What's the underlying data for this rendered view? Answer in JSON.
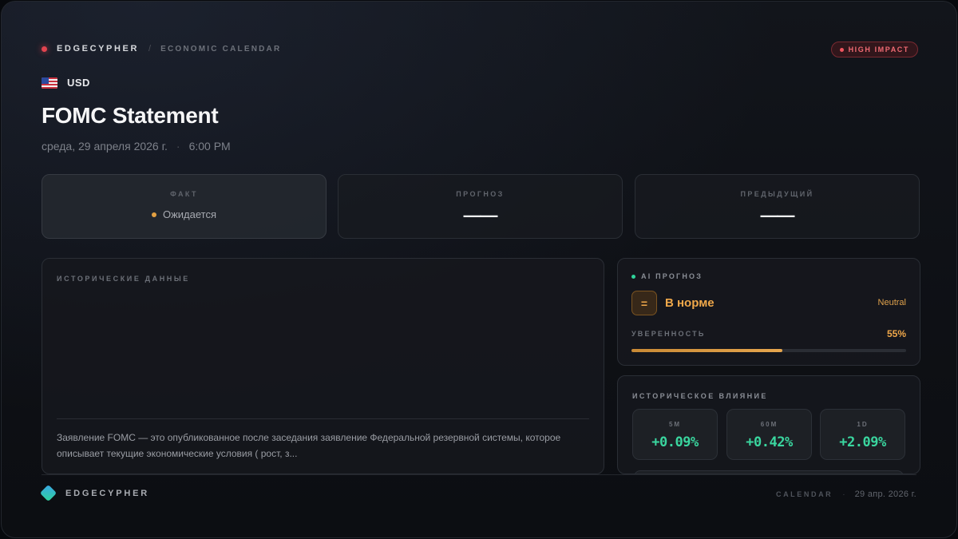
{
  "header": {
    "brand": "EDGECYPHER",
    "separator": "/",
    "breadcrumb": "ECONOMIC CALENDAR",
    "impact_badge": "HIGH IMPACT"
  },
  "event": {
    "currency": "USD",
    "title": "FOMC Statement",
    "date": "среда, 29 апреля 2026 г.",
    "time": "6:00 PM"
  },
  "stats": {
    "actual": {
      "label": "ФАКТ",
      "value": "Ожидается"
    },
    "forecast": {
      "label": "ПРОГНОЗ",
      "value": "——"
    },
    "previous": {
      "label": "ПРЕДЫДУЩИЙ",
      "value": "——"
    }
  },
  "historical": {
    "title": "ИСТОРИЧЕСКИЕ ДАННЫЕ",
    "description": "Заявление FOMC — это опубликованное после заседания заявление Федеральной резервной системы, которое описывает текущие экономические условия ( рост, з..."
  },
  "ai_forecast": {
    "title": "AI ПРОГНОЗ",
    "icon_symbol": "=",
    "status": "В норме",
    "sentiment": "Neutral",
    "confidence_label": "УВЕРЕННОСТЬ",
    "confidence_text": "55%",
    "confidence_value": 0.55
  },
  "historical_impact": {
    "title": "ИСТОРИЧЕСКОЕ ВЛИЯНИЕ",
    "items": [
      {
        "label": "5M",
        "value": "+0.09%"
      },
      {
        "label": "60M",
        "value": "+0.42%"
      },
      {
        "label": "1D",
        "value": "+2.09%"
      }
    ]
  },
  "footer": {
    "brand": "EDGECYPHER",
    "section": "CALENDAR",
    "date": "29 апр. 2026 г."
  },
  "colors": {
    "accent_orange": "#f0a84a",
    "positive_green": "#3ad69f",
    "high_impact_red": "#f06a73"
  }
}
